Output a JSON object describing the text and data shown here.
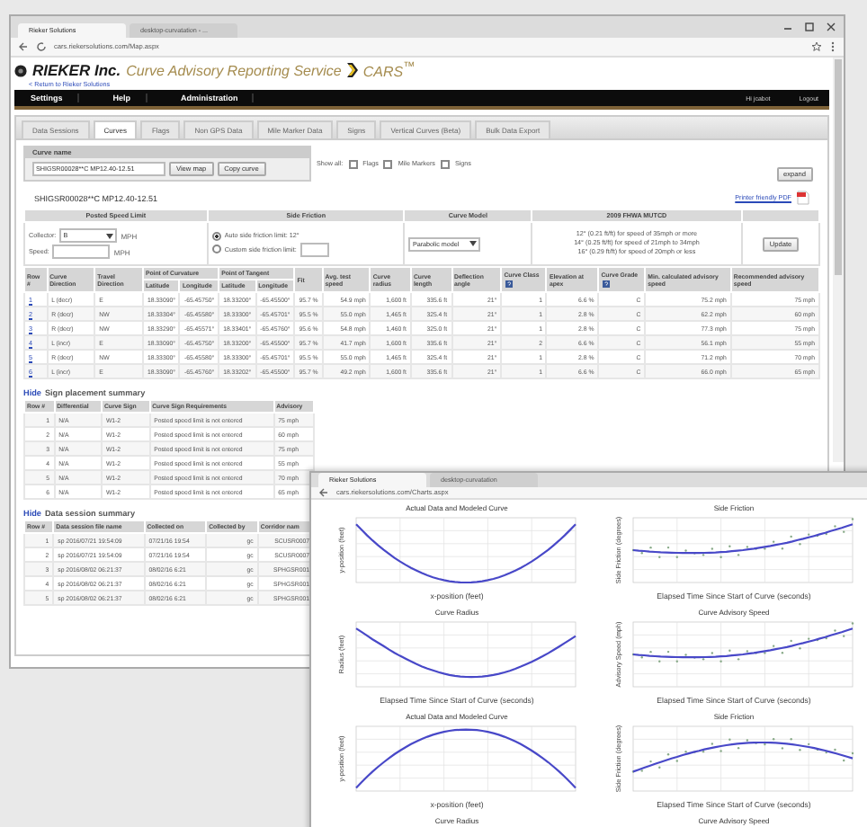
{
  "browser": {
    "tabs": [
      {
        "label": "Rieker Solutions",
        "selected": true
      },
      {
        "label": "desktop-curvatation - ...",
        "selected": false
      }
    ],
    "url": "cars.riekersolutions.com/Map.aspx"
  },
  "header": {
    "company": "RIEKER Inc.",
    "service": "Curve Advisory Reporting Service",
    "product": "CARS$^{™}$"
  },
  "return_link": "< Return to Rieker Solutions",
  "nav": {
    "items": [
      "Settings",
      "Help",
      "Administration"
    ],
    "user": "Hi jcabot",
    "logout": "Logout"
  },
  "tabs": [
    {
      "label": "Data Sessions",
      "selected": false
    },
    {
      "label": "Curves",
      "selected": true
    },
    {
      "label": "Flags",
      "selected": false
    },
    {
      "label": "Non GPS Data",
      "selected": false
    },
    {
      "label": "Mile Marker Data",
      "selected": false
    },
    {
      "label": "Signs",
      "selected": false
    },
    {
      "label": "Vertical Curves (Beta)",
      "selected": false
    },
    {
      "label": "Bulk Data Export",
      "selected": false
    }
  ],
  "curve_name": {
    "label": "Curve name",
    "value": "SHIGSR00028**C MP12.40-12.51",
    "buttons": [
      "View map",
      "Copy curve"
    ],
    "show_all": "Show all:",
    "checks": [
      {
        "label": "Flags",
        "checked": false
      },
      {
        "label": "Mile Markers",
        "checked": false
      },
      {
        "label": "Signs",
        "checked": false
      }
    ],
    "expand": "expand"
  },
  "curve_title": "SHIGSR00028**C MP12.40-12.51",
  "pdf_link": "Printer friendly PDF",
  "settings": {
    "headers": [
      "Posted Speed Limit",
      "Side Friction",
      "Curve Model",
      "2009 FHWA MUTCD"
    ],
    "speed_rows": [
      {
        "label": "Collector:",
        "value": "B",
        "unit": "MPH",
        "kind": "select"
      },
      {
        "label": "Speed:",
        "unit": "MPH",
        "kind": "input"
      }
    ],
    "friction_options": [
      {
        "label": "Auto side friction limit: 12°",
        "selected": true
      },
      {
        "label": "Custom side friction limit:",
        "selected": false
      }
    ],
    "model": "Parabolic model",
    "mutcd": [
      "12° (0.21 ft/ft) for speed of 35mph or more",
      "14° (0.25 ft/ft) for speed of 21mph to 34mph",
      "16° (0.29 ft/ft) for speed of 20mph or less"
    ],
    "update": "Update"
  },
  "curve_table": {
    "column_groups": [
      {
        "label": "Point of Curvature"
      },
      {
        "label": "Point of Tangent"
      }
    ],
    "columns": [
      {
        "label": "Row #",
        "help": false
      },
      {
        "label": "Curve Direction",
        "help": false
      },
      {
        "label": "Travel Direction",
        "help": false
      },
      {
        "label": "Latitude",
        "kind": "group_first",
        "help": false
      },
      {
        "label": "Longitude",
        "kind": "group_rest",
        "help": false
      },
      {
        "label": "Latitude",
        "kind": "group_first",
        "help": false
      },
      {
        "label": "Longitude",
        "kind": "group_rest",
        "help": false
      },
      {
        "label": "Fit",
        "help": false
      },
      {
        "label": "Avg. test speed",
        "help": false
      },
      {
        "label": "Curve radius",
        "help": false
      },
      {
        "label": "Curve length",
        "help": false
      },
      {
        "label": "Deflection angle",
        "help": false
      },
      {
        "label": "Curve Class",
        "help": true
      },
      {
        "label": "Elevation at apex",
        "help": false
      },
      {
        "label": "Curve Grade",
        "help": true
      },
      {
        "label": "Min. calculated advisory speed",
        "help": false
      },
      {
        "label": "Recommended advisory speed",
        "help": false
      }
    ],
    "rows": [
      [
        "1",
        "L (decr)",
        "E",
        "18.33090°",
        "-65.45750°",
        "18.33200°",
        "-65.45500°",
        "95.7 %",
        "54.9 mph",
        "1,600 ft",
        "335.6 ft",
        "21°",
        "1",
        "6.6 %",
        "C",
        "75.2 mph",
        "75 mph"
      ],
      [
        "2",
        "R (decr)",
        "NW",
        "18.33304°",
        "-65.45580°",
        "18.33300°",
        "-65.45701°",
        "95.5 %",
        "55.0 mph",
        "1,465 ft",
        "325.4 ft",
        "21°",
        "1",
        "2.8 %",
        "C",
        "62.2 mph",
        "60 mph"
      ],
      [
        "3",
        "R (decr)",
        "NW",
        "18.33290°",
        "-65.45571°",
        "18.33401°",
        "-65.45760°",
        "95.6 %",
        "54.8 mph",
        "1,460 ft",
        "325.0 ft",
        "21°",
        "1",
        "2.8 %",
        "C",
        "77.3 mph",
        "75 mph"
      ],
      [
        "4",
        "L (incr)",
        "E",
        "18.33090°",
        "-65.45750°",
        "18.33200°",
        "-65.45500°",
        "95.7 %",
        "41.7 mph",
        "1,600 ft",
        "335.6 ft",
        "21°",
        "2",
        "6.6 %",
        "C",
        "56.1 mph",
        "55 mph"
      ],
      [
        "5",
        "R (decr)",
        "NW",
        "18.33300°",
        "-65.45580°",
        "18.33300°",
        "-65.45701°",
        "95.5 %",
        "55.0 mph",
        "1,465 ft",
        "325.4 ft",
        "21°",
        "1",
        "2.8 %",
        "C",
        "71.2 mph",
        "70 mph"
      ],
      [
        "6",
        "L (incr)",
        "E",
        "18.33090°",
        "-65.45760°",
        "18.33202°",
        "-65.45500°",
        "95.7 %",
        "49.2 mph",
        "1,600 ft",
        "335.6 ft",
        "21°",
        "1",
        "6.6 %",
        "C",
        "66.0 mph",
        "65 mph"
      ]
    ]
  },
  "sign_summary": {
    "hide": "Hide",
    "title": "Sign placement summary",
    "columns": [
      "Row #",
      "Differential",
      "Curve Sign",
      "Curve Sign Requirements",
      "Advisory"
    ],
    "rows": [
      [
        "1",
        "N/A",
        "W1-2",
        "Posted speed limit is not entered",
        "75 mph"
      ],
      [
        "2",
        "N/A",
        "W1-2",
        "Posted speed limit is not entered",
        "60 mph"
      ],
      [
        "3",
        "N/A",
        "W1-2",
        "Posted speed limit is not entered",
        "75 mph"
      ],
      [
        "4",
        "N/A",
        "W1-2",
        "Posted speed limit is not entered",
        "55 mph"
      ],
      [
        "5",
        "N/A",
        "W1-2",
        "Posted speed limit is not entered",
        "70 mph"
      ],
      [
        "6",
        "N/A",
        "W1-2",
        "Posted speed limit is not entered",
        "65 mph"
      ]
    ]
  },
  "session_summary": {
    "hide": "Hide",
    "title": "Data session summary",
    "columns": [
      "Row #",
      "Data session file name",
      "Collected on",
      "Collected by",
      "Corridor nam"
    ],
    "rows": [
      [
        "1",
        "sp 2016/07/21 19:54:09",
        "07/21/16 19:54",
        "gc",
        "SCUSR0007"
      ],
      [
        "2",
        "sp 2016/07/21 19:54:09",
        "07/21/16 19:54",
        "gc",
        "SCUSR0007"
      ],
      [
        "3",
        "sp 2016/08/02 06:21:37",
        "08/02/16 6:21",
        "gc",
        "SPHGSR001"
      ],
      [
        "4",
        "sp 2016/08/02 06:21:37",
        "08/02/16 6:21",
        "gc",
        "SPHGSR001"
      ],
      [
        "5",
        "sp 2016/08/02 06:21:37",
        "08/02/16 6:21",
        "gc",
        "SPHGSR001"
      ]
    ]
  },
  "chart_window": {
    "tabs": [
      {
        "label": "Rieker Solutions",
        "selected": true
      },
      {
        "label": "desktop-curvatation",
        "selected": false
      }
    ],
    "url": "cars.riekersolutions.com/Charts.aspx",
    "charts": [
      {
        "title": "Actual Data and Modeled Curve",
        "kind": "parabola_up",
        "xlabel": "x-position (feet)",
        "ylabel": "y-position (feet)"
      },
      {
        "title": "Side Friction",
        "kind": "friction_up",
        "xlabel": "Elapsed Time Since Start of Curve (seconds)",
        "ylabel": "Side Friction (degrees)"
      },
      {
        "title": "Curve Radius",
        "kind": "radius",
        "xlabel": "Elapsed Time Since Start of Curve (seconds)",
        "ylabel": "Radius (feet)"
      },
      {
        "title": "Curve Advisory Speed",
        "kind": "speed",
        "xlabel": "Elapsed Time Since Start of Curve (seconds)",
        "ylabel": "Advisory Speed (mph)"
      },
      {
        "title": "Actual Data and Modeled Curve",
        "kind": "parabola_down",
        "xlabel": "x-position (feet)",
        "ylabel": "y-position (feet)"
      },
      {
        "title": "Side Friction",
        "kind": "friction_arch",
        "xlabel": "Elapsed Time Since Start of Curve (seconds)",
        "ylabel": "Side Friction (degrees)"
      },
      {
        "title": "Curve Radius",
        "kind": "title_only"
      },
      {
        "title": "Curve Advisory Speed",
        "kind": "title_only"
      }
    ]
  }
}
